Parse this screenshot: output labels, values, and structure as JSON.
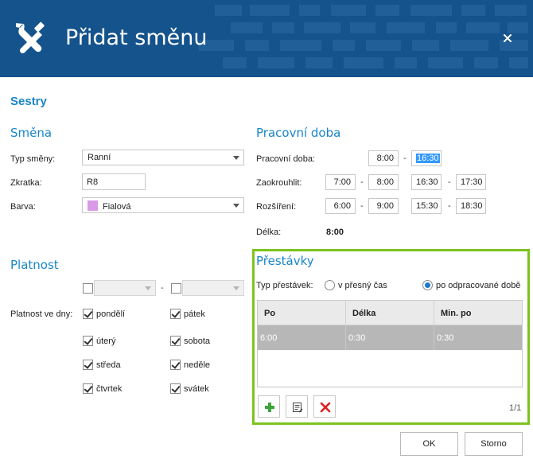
{
  "window": {
    "title": "Přidat směnu",
    "close_icon": "close-icon",
    "app_icon": "wrench-screwdriver-icon",
    "accent": "#15538c"
  },
  "ward": "Sestry",
  "shift": {
    "heading": "Směna",
    "type_label": "Typ směny:",
    "type_value": "Ranní",
    "abbr_label": "Zkratka:",
    "abbr_value": "R8",
    "color_label": "Barva:",
    "color_value": "Fialová",
    "color_hex": "#d99ae6"
  },
  "worktime": {
    "heading": "Pracovní doba",
    "work_label": "Pracovní doba:",
    "work_from": "8:00",
    "work_to": "16:30",
    "round_label": "Zaokrouhlit:",
    "round": [
      "7:00",
      "8:00",
      "16:30",
      "17:30"
    ],
    "extend_label": "Rozšíření:",
    "extend": [
      "6:00",
      "9:00",
      "15:30",
      "18:30"
    ],
    "length_label": "Délka:",
    "length_value": "8:00",
    "separator": "-"
  },
  "validity": {
    "heading": "Platnost",
    "days_label": "Platnost ve dny:",
    "days": [
      {
        "label": "pondělí",
        "checked": true
      },
      {
        "label": "úterý",
        "checked": true
      },
      {
        "label": "středa",
        "checked": true
      },
      {
        "label": "čtvrtek",
        "checked": true
      },
      {
        "label": "pátek",
        "checked": true
      },
      {
        "label": "sobota",
        "checked": true
      },
      {
        "label": "neděle",
        "checked": true
      },
      {
        "label": "svátek",
        "checked": true
      }
    ]
  },
  "breaks": {
    "heading": "Přestávky",
    "type_label": "Typ přestávek:",
    "option_exact": "v přesný čas",
    "option_worked": "po odpracované době",
    "selected": "option_worked",
    "columns": [
      "Po",
      "Délka",
      "Min. po"
    ],
    "rows": [
      [
        "6:00",
        "0:30",
        "0:30"
      ]
    ],
    "pager": "1/1",
    "highlight": "#7cc31e"
  },
  "footer": {
    "ok": "OK",
    "cancel": "Storno"
  }
}
